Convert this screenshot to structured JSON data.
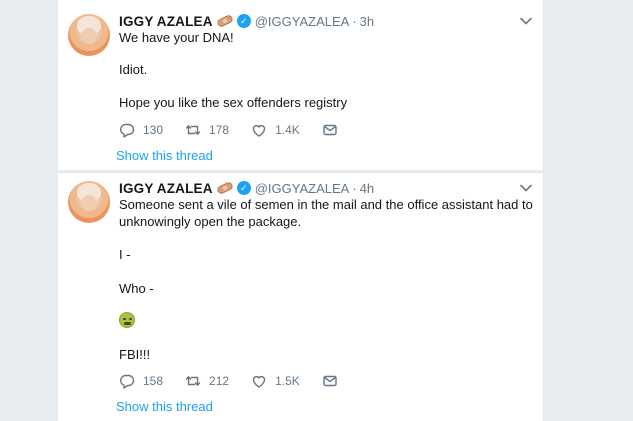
{
  "tweets": [
    {
      "name": "IGGY AZALEA",
      "handle": "@IGGYAZALEA",
      "separator": "·",
      "time": "3h",
      "lines": [
        "We have your DNA!",
        "Idiot.",
        "Hope you like the sex offenders registry"
      ],
      "replies": "130",
      "retweets": "178",
      "likes": "1.4K",
      "show_thread": "Show this thread"
    },
    {
      "name": "IGGY AZALEA",
      "handle": "@IGGYAZALEA",
      "separator": "·",
      "time": "4h",
      "lines": [
        "Someone sent a vile of semen in the mail and the office assistant had to",
        "unknowingly open the package.",
        "I -",
        "Who -",
        "FBI!!!"
      ],
      "replies": "158",
      "retweets": "212",
      "likes": "1.5K",
      "show_thread": "Show this thread"
    }
  ],
  "icons": {
    "reply": "reply-icon",
    "retweet": "retweet-icon",
    "like": "like-icon",
    "message": "direct-message-icon",
    "caret": "chevron-down-icon",
    "verified": "verified-badge-icon",
    "bandaid": "adhesive-bandage-emoji",
    "sick": "nauseated-face-emoji"
  },
  "colors": {
    "link": "#1da1f2",
    "secondary": "#657786",
    "text": "#14171a",
    "background": "#e6ecf0"
  }
}
